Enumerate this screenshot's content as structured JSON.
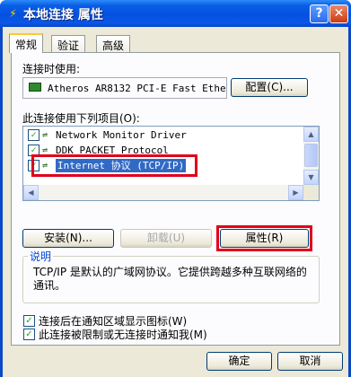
{
  "window": {
    "title": "本地连接 属性",
    "help_glyph": "?",
    "close_glyph": "✕",
    "title_icon": "network-connection-icon"
  },
  "tabs": [
    {
      "label": "常规",
      "active": true
    },
    {
      "label": "验证",
      "active": false
    },
    {
      "label": "高级",
      "active": false
    }
  ],
  "connect_using": {
    "label": "连接时使用:",
    "adapter": "Atheros AR8132 PCI-E Fast Ethe",
    "adapter_icon": "network-adapter-icon",
    "configure_button": "配置(C)..."
  },
  "items_section": {
    "label": "此连接使用下列项目(O):",
    "items": [
      {
        "label": "Network Monitor Driver",
        "checked": true,
        "icon": "network-protocol-icon"
      },
      {
        "label": "DDK PACKET Protocol",
        "checked": true,
        "icon": "network-protocol-icon"
      },
      {
        "label": "Internet 协议 (TCP/IP)",
        "checked": true,
        "selected": true,
        "icon": "network-protocol-icon"
      }
    ]
  },
  "buttons": {
    "install": "安装(N)...",
    "uninstall": "卸载(U)",
    "properties": "属性(R)",
    "ok": "确定",
    "cancel": "取消"
  },
  "description": {
    "title": "说明",
    "text": "TCP/IP 是默认的广域网协议。它提供跨越多种互联网络的通讯。"
  },
  "options": [
    {
      "label": "连接后在通知区域显示图标(W)",
      "checked": true
    },
    {
      "label": "此连接被限制或无连接时通知我(M)",
      "checked": true
    }
  ],
  "colors": {
    "title_bar": "#0a5fe6",
    "highlight_box": "#e0001a",
    "selection": "#316ac5",
    "tab_accent": "#ffc83c"
  }
}
